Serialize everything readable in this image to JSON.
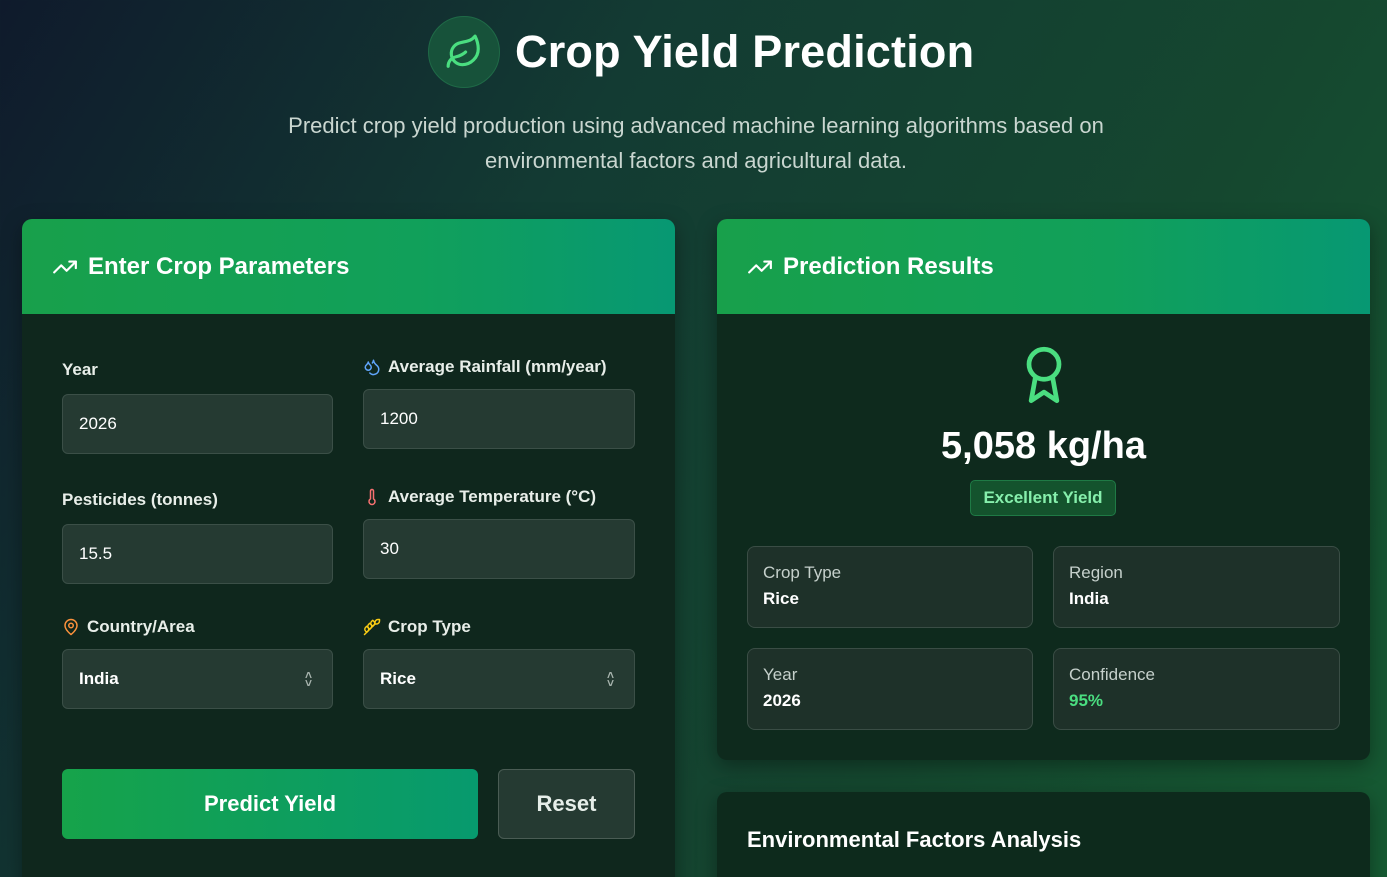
{
  "header": {
    "title": "Crop Yield Prediction",
    "subtitle": "Predict crop yield production using advanced machine learning algorithms based on environmental factors and agricultural data."
  },
  "params": {
    "heading": "Enter Crop Parameters",
    "year": {
      "label": "Year",
      "value": "2026"
    },
    "rainfall": {
      "label": "Average Rainfall (mm/year)",
      "value": "1200",
      "icon": "droplets-icon"
    },
    "pesticides": {
      "label": "Pesticides (tonnes)",
      "value": "15.5"
    },
    "temperature": {
      "label": "Average Temperature (°C)",
      "value": "30",
      "icon": "thermometer-icon"
    },
    "country": {
      "label": "Country/Area",
      "value": "India",
      "icon": "map-pin-icon"
    },
    "crop": {
      "label": "Crop Type",
      "value": "Rice",
      "icon": "wheat-icon"
    },
    "predict_label": "Predict Yield",
    "reset_label": "Reset"
  },
  "results": {
    "heading": "Prediction Results",
    "yield": "5,058 kg/ha",
    "badge": "Excellent Yield",
    "tiles": [
      {
        "label": "Crop Type",
        "value": "Rice"
      },
      {
        "label": "Region",
        "value": "India"
      },
      {
        "label": "Year",
        "value": "2026"
      },
      {
        "label": "Confidence",
        "value": "95%"
      }
    ]
  },
  "env": {
    "heading": "Environmental Factors Analysis"
  },
  "colors": {
    "accent": "#16a34a",
    "accent_teal": "#079a6e",
    "success_text": "#4ade80",
    "badge_bg": "#14532d"
  }
}
